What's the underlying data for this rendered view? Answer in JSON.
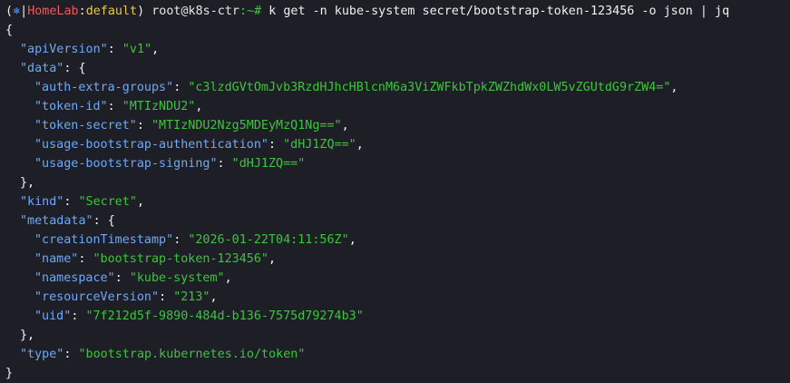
{
  "prompt": {
    "open_paren": "(",
    "kube_icon": "⎈",
    "separator": "|",
    "cluster": "HomeLab",
    "colon": ":",
    "namespace": "default",
    "close_paren": ")",
    "user_host": "root@k8s-ctr",
    "path": ":~#",
    "command": "k get -n kube-system secret/bootstrap-token-123456 -o json | jq"
  },
  "json": {
    "apiVersion_key": "\"apiVersion\"",
    "apiVersion_val": "\"v1\"",
    "data_key": "\"data\"",
    "data": [
      {
        "key": "\"auth-extra-groups\"",
        "value": "\"c3lzdGVtOmJvb3RzdHJhcHBlcnM6a3ViZWFkbTpkZWZhdWx0LW5vZGUtdG9rZW4=\""
      },
      {
        "key": "\"token-id\"",
        "value": "\"MTIzNDU2\""
      },
      {
        "key": "\"token-secret\"",
        "value": "\"MTIzNDU2Nzg5MDEyMzQ1Ng==\""
      },
      {
        "key": "\"usage-bootstrap-authentication\"",
        "value": "\"dHJ1ZQ==\""
      },
      {
        "key": "\"usage-bootstrap-signing\"",
        "value": "\"dHJ1ZQ==\""
      }
    ],
    "kind_key": "\"kind\"",
    "kind_val": "\"Secret\"",
    "metadata_key": "\"metadata\"",
    "metadata": [
      {
        "key": "\"creationTimestamp\"",
        "value": "\"2026-01-22T04:11:56Z\""
      },
      {
        "key": "\"name\"",
        "value": "\"bootstrap-token-123456\""
      },
      {
        "key": "\"namespace\"",
        "value": "\"kube-system\""
      },
      {
        "key": "\"resourceVersion\"",
        "value": "\"213\""
      },
      {
        "key": "\"uid\"",
        "value": "\"7f212d5f-9890-484d-b136-7575d79274b3\""
      }
    ],
    "type_key": "\"type\"",
    "type_val": "\"bootstrap.kubernetes.io/token\""
  },
  "colors": {
    "background": "#1e1f26",
    "key": "#6fa8f6",
    "string": "#3cc43c",
    "text": "#f0f0f0"
  }
}
